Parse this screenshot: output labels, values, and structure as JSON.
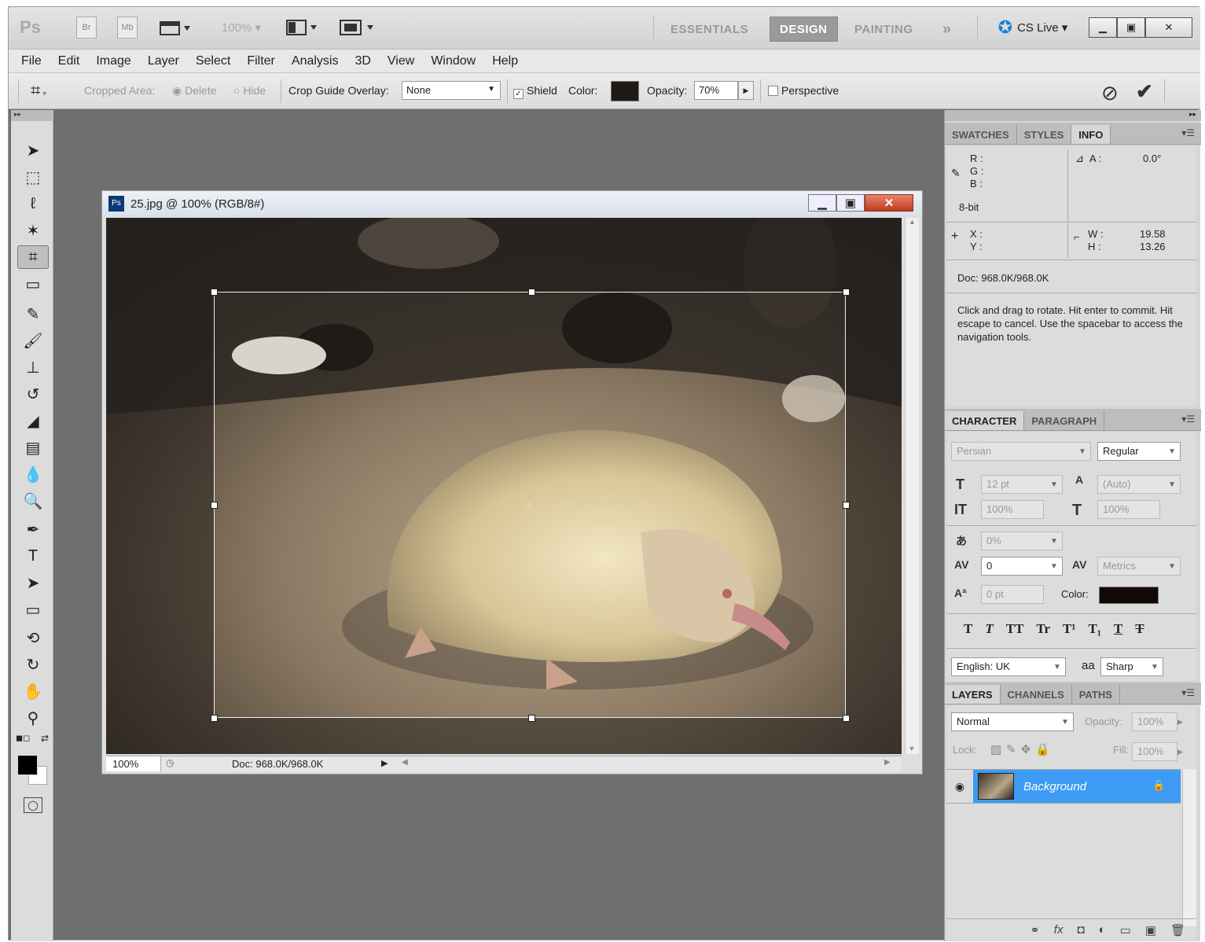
{
  "app": {
    "logo": "Ps",
    "bridge": "Br",
    "minibridge": "Mb",
    "zoom": "100%",
    "workspaces": [
      "ESSENTIALS",
      "DESIGN",
      "PAINTING"
    ],
    "more": "»",
    "cslive": "CS Live"
  },
  "menu": [
    "File",
    "Edit",
    "Image",
    "Layer",
    "Select",
    "Filter",
    "Analysis",
    "3D",
    "View",
    "Window",
    "Help"
  ],
  "options": {
    "cropped_area": "Cropped Area:",
    "delete": "Delete",
    "hide": "Hide",
    "crop_guide": "Crop Guide Overlay:",
    "crop_guide_value": "None",
    "shield": "Shield",
    "color": "Color:",
    "opacity": "Opacity:",
    "opacity_value": "70%",
    "perspective": "Perspective",
    "shield_color": "#1e1a18"
  },
  "document": {
    "title": "25.jpg @ 100% (RGB/8#)",
    "zoom": "100%",
    "doc_size": "Doc: 968.0K/968.0K"
  },
  "info_panel": {
    "tabs": [
      "SWATCHES",
      "STYLES",
      "INFO"
    ],
    "r": "R :",
    "g": "G :",
    "b": "B :",
    "angle_label": "A :",
    "angle": "0.0°",
    "bit": "8-bit",
    "x": "X :",
    "y": "Y :",
    "w_label": "W :",
    "h_label": "H :",
    "w": "19.58",
    "h": "13.26",
    "doc": "Doc: 968.0K/968.0K",
    "help": "Click and drag to rotate. Hit enter to commit. Hit escape to cancel. Use the spacebar to access the navigation tools."
  },
  "character": {
    "tabs": [
      "CHARACTER",
      "PARAGRAPH"
    ],
    "font": "Persian",
    "style": "Regular",
    "size": "12 pt",
    "leading": "(Auto)",
    "vscale": "100%",
    "hscale": "100%",
    "tsume": "0%",
    "tracking": "0",
    "kerning": "Metrics",
    "baseline": "0 pt",
    "color_label": "Color:",
    "language": "English: UK",
    "aa_label": "aa",
    "antialias": "Sharp",
    "text_color": "#120808"
  },
  "layers": {
    "tabs": [
      "LAYERS",
      "CHANNELS",
      "PATHS"
    ],
    "blend": "Normal",
    "opacity_label": "Opacity:",
    "opacity": "100%",
    "lock_label": "Lock:",
    "fill_label": "Fill:",
    "fill": "100%",
    "layer_name": "Background"
  }
}
